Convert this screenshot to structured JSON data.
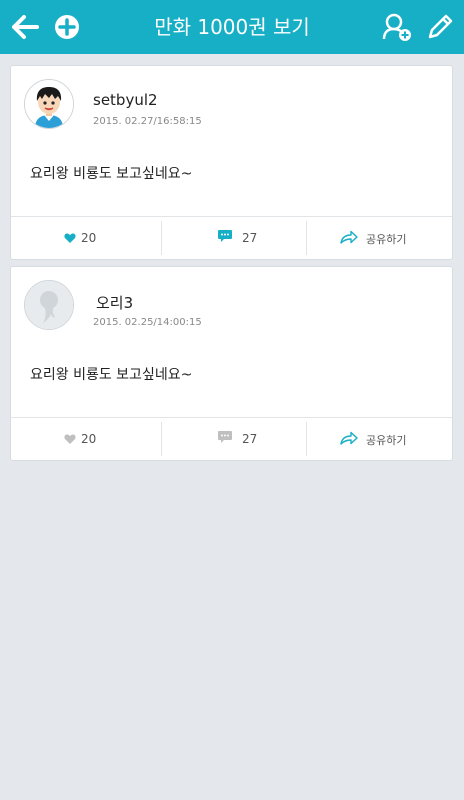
{
  "header": {
    "title": "만화 1000권 보기",
    "back_icon": "arrow-left-icon",
    "add_icon": "plus-circle-icon",
    "add_friend_icon": "add-person-icon",
    "write_icon": "pencil-icon",
    "bar_color": "#16afc5"
  },
  "posts": [
    {
      "username": "setbyul2",
      "timestamp": "2015. 02.27/16:58:15",
      "content": "요리왕 비룡도 보고싶네요~",
      "likes": "20",
      "comments": "27",
      "share_label": "공유하기",
      "like_color": "#16afc5",
      "comment_color": "#16afc5"
    },
    {
      "username": "오리3",
      "timestamp": "2015. 02.25/14:00:15",
      "content": "요리왕 비룡도 보고싶네요~",
      "likes": "20",
      "comments": "27",
      "share_label": "공유하기",
      "like_color": "#bfbfbf",
      "comment_color": "#bfbfbf"
    }
  ]
}
